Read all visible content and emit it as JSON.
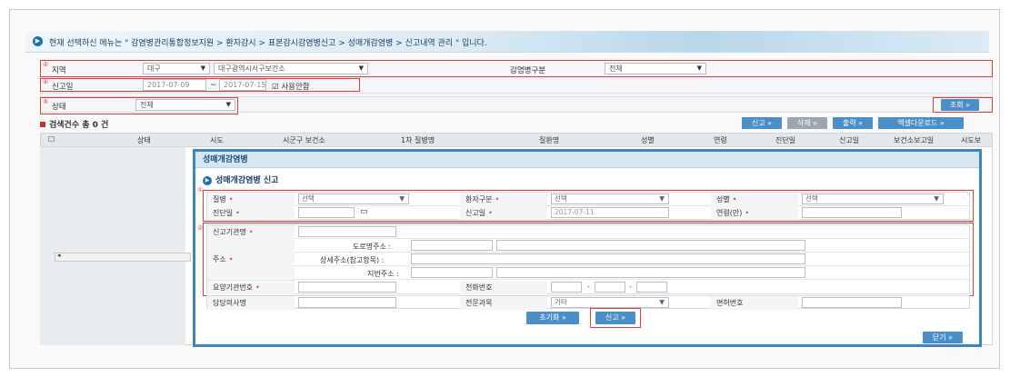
{
  "breadcrumb": "현재 선택하신 메뉴는 \" 감염병관리통합정보지원 > 환자감시 > 표본감시감염병신고 > 성매개감염병 > 신고내역 관리 \" 입니다.",
  "filter": {
    "region_label": "지역",
    "region_value": "대구",
    "center_value": "대구광역시서구보건소",
    "infection_type_label": "감염병구분",
    "infection_type_value": "전체",
    "report_date_label": "신고일",
    "date_from": "2017-07-09",
    "date_to": "2017-07-15",
    "date_sep": "~",
    "use_limit_label": "사용안함",
    "status_label": "상태",
    "status_value": "전체",
    "search_button": "조회 »"
  },
  "markers": [
    "①",
    "②",
    "③",
    "④",
    "⑤"
  ],
  "result": {
    "count_label": "검색건수 총 0 건",
    "report_button": "신고 »",
    "delete_button": "삭제 »",
    "print_button": "출력 »",
    "excel_button": "엑셀다운로드 »"
  },
  "grid": {
    "columns": [
      "상태",
      "시도",
      "시군구 보건소",
      "1차 질병명",
      "질환명",
      "성별",
      "연령",
      "진단일",
      "신고일",
      "보건소보고일",
      "시도보"
    ]
  },
  "modal": {
    "title": "성매개감염병",
    "subtitle": "성매개감염병 신고",
    "disease_label": "질병",
    "disease_value": "선택",
    "patient_type_label": "환자구분",
    "patient_type_value": "선택",
    "sex_label": "성별",
    "sex_value": "선택",
    "diagnosis_date_label": "진단일",
    "report_date_label": "신고일",
    "report_date_value": "2017-07-11",
    "age_label": "연령(만)",
    "institution_label": "신고기관명",
    "address_label": "주소",
    "road_address_label": "도로명주소 :",
    "detail_address_label": "상세주소(참고항목) :",
    "lot_address_label": "지번주소 :",
    "institution_no_label": "요양기관번호",
    "phone_label": "전화번호",
    "phone_sep": "-",
    "doctor_label": "담당의사명",
    "specialty_label": "전문과목",
    "specialty_value": "기타",
    "license_label": "면허번호",
    "reset_button": "초기화 »",
    "submit_button": "신고 »",
    "close_button": "닫기 »",
    "section1": "①",
    "section2": "②"
  },
  "colors": {
    "accent": "#4b8fc8",
    "highlight": "#e03b3b",
    "modal_border": "#3e86c0"
  }
}
